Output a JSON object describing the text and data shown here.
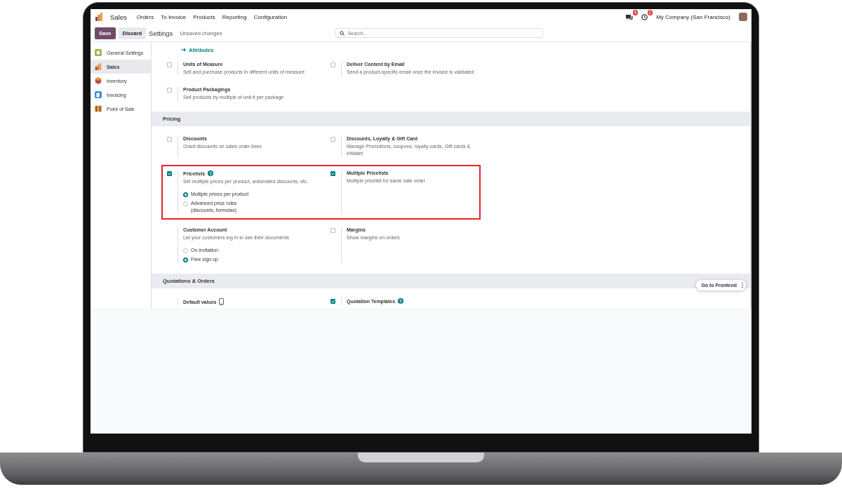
{
  "navbar": {
    "app_name": "Sales",
    "menu": [
      "Orders",
      "To Invoice",
      "Products",
      "Reporting",
      "Configuration"
    ],
    "messages_badge": "4",
    "activities_badge": "2",
    "company": "My Company (San Francisco)"
  },
  "control_panel": {
    "save": "Save",
    "discard": "Discard",
    "title": "Settings",
    "status": "Unsaved changes",
    "search": {
      "placeholder": "Search..."
    }
  },
  "sidebar": {
    "items": [
      {
        "label": "General Settings",
        "kind": "general",
        "selected": false
      },
      {
        "label": "Sales",
        "kind": "sales",
        "selected": true
      },
      {
        "label": "Inventory",
        "kind": "inventory",
        "selected": false
      },
      {
        "label": "Invoicing",
        "kind": "invoicing",
        "selected": false
      },
      {
        "label": "Point of Sale",
        "kind": "pos",
        "selected": false
      }
    ]
  },
  "sections": [
    {
      "link": "Attributes",
      "rows": [
        {
          "highlighted": false,
          "cells": [
            {
              "kind": "checkbox",
              "checked": false,
              "title": "Units of Measure",
              "description": "Sell and purchase products in different units of measure"
            },
            {
              "kind": "checkbox",
              "checked": false,
              "title": "Deliver Content by Email",
              "description": "Send a product-specific email once the invoice is validated"
            }
          ]
        },
        {
          "highlighted": false,
          "cells": [
            {
              "kind": "checkbox",
              "checked": false,
              "title": "Product Packagings",
              "description": "Sell products by multiple of unit # per package"
            }
          ]
        }
      ]
    },
    {
      "title": "Pricing",
      "rows": [
        {
          "highlighted": false,
          "cells": [
            {
              "kind": "checkbox",
              "checked": false,
              "title": "Discounts",
              "description": "Grant discounts on sales order lines"
            },
            {
              "kind": "checkbox",
              "checked": false,
              "title": "Discounts, Loyalty & Gift Card",
              "description": "Manage Promotions, coupons, loyalty cards, Gift cards & eWallet"
            }
          ]
        },
        {
          "highlighted": true,
          "cells": [
            {
              "kind": "checkbox",
              "checked": true,
              "help": "?",
              "title": "Pricelists",
              "description": "Set multiple prices per product, automated discounts, etc.",
              "options": [
                {
                  "label": "Multiple prices per product",
                  "selected": true
                },
                {
                  "label": "Advanced price rules\n(discounts, formulas)",
                  "selected": false
                }
              ]
            },
            {
              "kind": "checkbox",
              "checked": true,
              "title": "Multiple Pricelists",
              "description": "Multiple pricelist for same sale order"
            }
          ]
        },
        {
          "highlighted": false,
          "cells": [
            {
              "kind": "plain",
              "title": "Customer Account",
              "description": "Let your customers log in to see their documents",
              "options": [
                {
                  "label": "On invitation",
                  "selected": false
                },
                {
                  "label": "Free sign up",
                  "selected": true
                }
              ]
            },
            {
              "kind": "checkbox",
              "checked": false,
              "title": "Margins",
              "description": "Show margins on orders"
            }
          ]
        }
      ]
    },
    {
      "title": "Quotations & Orders",
      "rows": [
        {
          "highlighted": false,
          "cells": [
            {
              "kind": "plain",
              "mobile_icon": true,
              "title": "Default values"
            },
            {
              "kind": "checkbox",
              "checked": true,
              "help": "?",
              "title": "Quotation Templates"
            }
          ]
        }
      ]
    }
  ],
  "floating": {
    "button": "Go to Frontend"
  }
}
